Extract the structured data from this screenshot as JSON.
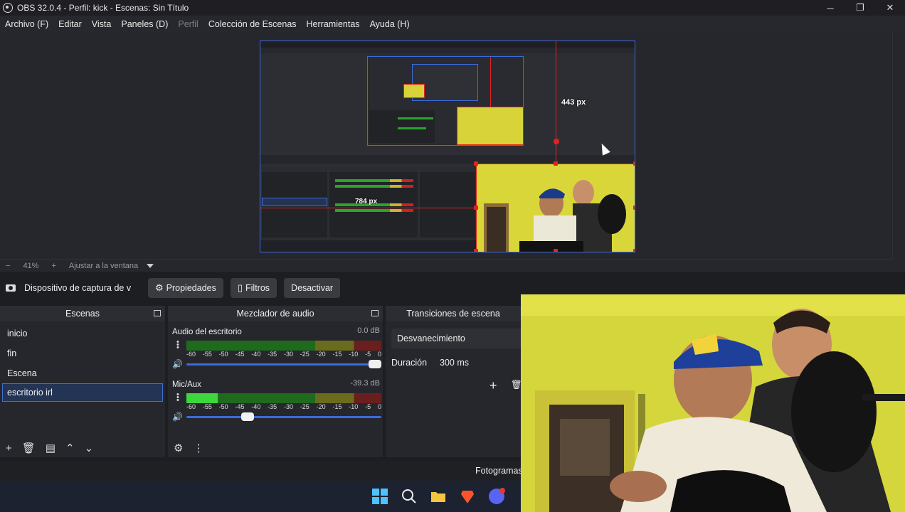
{
  "window": {
    "title": "OBS 32.0.4 - Perfil: kick - Escenas: Sin Título",
    "minimize": "─",
    "maximize": "❐",
    "close": "✕"
  },
  "menu": {
    "items": [
      {
        "label": "Archivo (F)",
        "enabled": true
      },
      {
        "label": "Editar",
        "enabled": true
      },
      {
        "label": "Vista",
        "enabled": true
      },
      {
        "label": "Paneles (D)",
        "enabled": true
      },
      {
        "label": "Perfil",
        "enabled": false
      },
      {
        "label": "Colección de Escenas",
        "enabled": true
      },
      {
        "label": "Herramientas",
        "enabled": true
      },
      {
        "label": "Ayuda (H)",
        "enabled": true
      }
    ]
  },
  "preview": {
    "measure_vertical": "443 px",
    "measure_horizontal": "784 px",
    "guide_color": "#e02323",
    "selection_color": "#3b6bdc"
  },
  "zoom": {
    "minus": "−",
    "level": "41%",
    "plus": "+",
    "fit_label": "Ajustar a la ventana"
  },
  "source_toolbar": {
    "source_name": "Dispositivo de captura de v",
    "properties": "Propiedades",
    "filters": "Filtros",
    "deactivate": "Desactivar"
  },
  "scenes": {
    "title": "Escenas",
    "items": [
      "inicio",
      "fin",
      "Escena",
      "escritorio irl"
    ],
    "selected_index": 3
  },
  "mixer": {
    "title": "Mezclador de audio",
    "ticks": [
      "-60",
      "-55",
      "-50",
      "-45",
      "-40",
      "-35",
      "-30",
      "-25",
      "-20",
      "-15",
      "-10",
      "-5",
      "0"
    ],
    "channels": [
      {
        "name": "Audio del escritorio",
        "db": "0.0 dB",
        "level": 0,
        "volume": 1.0
      },
      {
        "name": "Mic/Aux",
        "db": "-39.3 dB",
        "level": 0.16,
        "volume": 0.3
      }
    ]
  },
  "transitions": {
    "title": "Transiciones de escena",
    "selected": "Desvanecimiento",
    "duration_label": "Duración",
    "duration_value": "300 ms",
    "add": "+"
  },
  "status": {
    "fps_label": "Fotogramas"
  },
  "colors": {
    "accent": "#3b6bdc",
    "webcam_wall": "#d9d63a"
  }
}
